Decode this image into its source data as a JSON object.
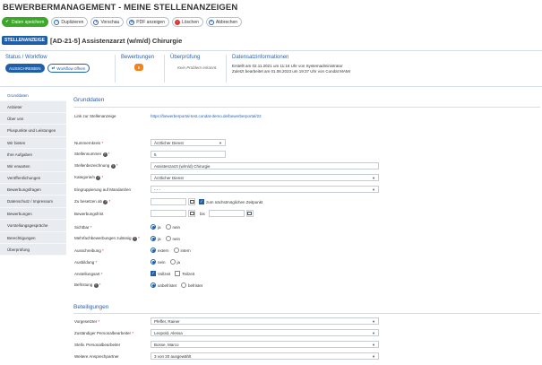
{
  "header": {
    "title": "BEWERBERMANAGEMENT - MEINE STELLENANZEIGEN"
  },
  "toolbar": {
    "save": "Daten speichern",
    "duplicate": "Duplizieren",
    "preview": "Vorschau",
    "pdf": "PDF anzeigen",
    "delete": "Löschen",
    "cancel": "Abbrechen"
  },
  "ad": {
    "badge": "STELLENANZEIGE",
    "title": "[AD-21-5] Assistenzarzt (w/m/d) Chirurgie"
  },
  "status": {
    "workflow_title": "Status / Workflow",
    "state_button": "AUSSCHREIBEN",
    "workflow_button": "Workflow öffnen",
    "applications_title": "Bewerbungen",
    "applications_count": "5",
    "review_title": "Überprüfung",
    "review_text": "Kein Problem erkannt.",
    "info_title": "Datensatzinformationen",
    "created": "Erstellt am 02.11.2021 um 11:16 Uhr von Systemadministrator",
    "edited": "Zuletzt bearbeitet am 01.06.2023 um 19:37 Uhr von Condat MAMI"
  },
  "sidebar": {
    "items": [
      "Grunddaten",
      "Anbieter",
      "Über uns",
      "Pluspunkte und Leistungen",
      "Wir bieten",
      "Ihre Aufgaben",
      "Wir erwarten",
      "Veröffentlichungen",
      "Bewerbungsfragen",
      "Datenschutz / Impressum",
      "Bewerbungen",
      "Vorstellungsgespräche",
      "Berechtigungen",
      "Überprüfung"
    ]
  },
  "form": {
    "section_title": "Grunddaten",
    "link_label": "Link zur Stellenanzeige",
    "link_value": "https://bewerberportal-test.condat-demo.de/bewerberportal/22",
    "nummernkreis_label": "Nummernkreis",
    "nummernkreis_value": "Ärztlicher Dienst",
    "stellennummer_label": "Stellennummer",
    "stellennummer_value": "5",
    "bezeichnung_label": "Stellenbezeichnung",
    "bezeichnung_value": "Assistenzarzt (w/m/d) Chirurgie",
    "kategorie_label": "Kategorie/n",
    "kategorie_value": "Ärztlicher Dienst",
    "eingruppierung_label": "Eingruppierung auf Mandant/en",
    "eingruppierung_value": "- - -",
    "zu_besetzen_label": "Zu besetzen ab",
    "zu_besetzen_check": "zum nächstmöglichen Zeitpunkt",
    "frist_label": "Bewerbungsfrist",
    "frist_bis": "bis",
    "sichtbar_label": "Sichtbar",
    "mehrfach_label": "Mehrfachbewerbungen zulässig",
    "ausschreibung_label": "Ausschreibung",
    "ausbildung_label": "Ausbildung",
    "anstellungsart_label": "Anstellungsart",
    "befristung_label": "Befristung",
    "opt_ja": "ja",
    "opt_nein": "nein",
    "opt_extern": "extern",
    "opt_intern": "intern",
    "opt_vollzeit": "Vollzeit",
    "opt_teilzeit": "Teilzeit",
    "opt_unbefristet": "unbefristet",
    "opt_befristet": "befristet"
  },
  "beteiligungen": {
    "section_title": "Beteiligungen",
    "vorgesetzter_label": "Vorgesetzter",
    "vorgesetzter_value": "Pfeffer, Rainer",
    "personal_label": "Zuständiger Personalbearbeiter",
    "personal_value": "Leopold, Alessa",
    "stellv_label": "Stellv. Personalbearbeiter",
    "stellv_value": "Bosse, Marco",
    "weitere_label": "Weitere Ansprechpartner",
    "weitere_value": "3 von 20 ausgewählt"
  },
  "colors": {
    "primary": "#1f5fa8",
    "save": "#3fa62d",
    "badge": "#f0851e",
    "required": "#d0302f"
  }
}
